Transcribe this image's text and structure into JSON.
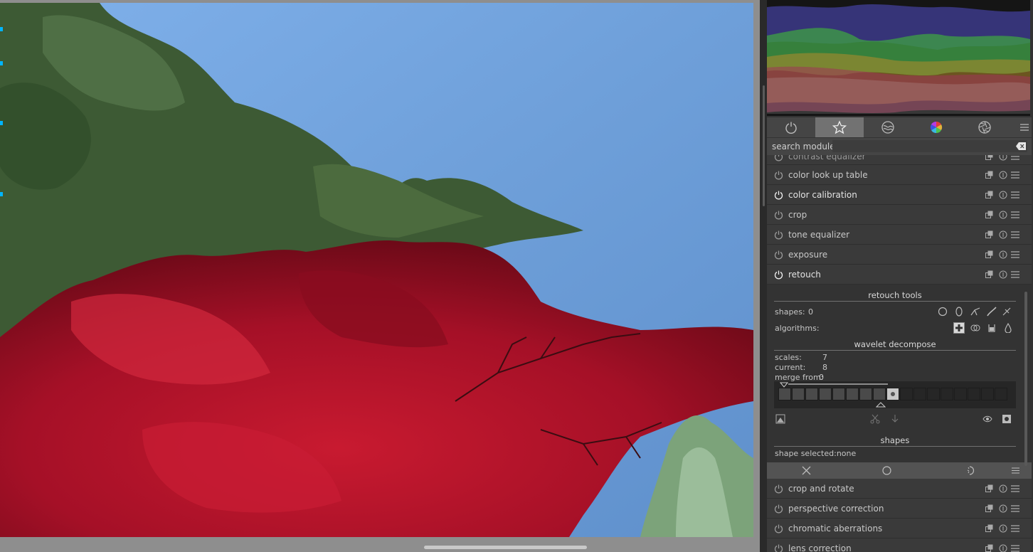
{
  "panel": {
    "search_label": "search module",
    "search_value": "",
    "tabs": [
      {
        "icon": "power-icon",
        "label": ""
      },
      {
        "icon": "star-icon",
        "label": "",
        "active": true
      },
      {
        "icon": "technical-icon",
        "label": ""
      },
      {
        "icon": "color-wheel-icon",
        "label": ""
      },
      {
        "icon": "aperture-icon",
        "label": ""
      }
    ],
    "modules_top": [
      {
        "name": "contrast equalizer",
        "enabled": false,
        "partial": true
      },
      {
        "name": "color look up table",
        "enabled": false
      },
      {
        "name": "color calibration",
        "enabled": true
      },
      {
        "name": "crop",
        "enabled": false
      },
      {
        "name": "tone equalizer",
        "enabled": false
      },
      {
        "name": "exposure",
        "enabled": false
      },
      {
        "name": "retouch",
        "enabled": true,
        "expanded": true
      }
    ],
    "retouch": {
      "tools_title": "retouch tools",
      "shapes_label": "shapes:",
      "shapes_count": "0",
      "algorithms_label": "algorithms:",
      "wavelet_title": "wavelet decompose",
      "scales_label": "scales:",
      "scales_value": "7",
      "current_label": "current:",
      "current_value": "8",
      "merge_label": "merge from:",
      "merge_value": "0",
      "shapes_title": "shapes",
      "shape_selected": "shape selected:none"
    },
    "modules_bottom": [
      {
        "name": "crop and rotate",
        "enabled": false
      },
      {
        "name": "perspective correction",
        "enabled": false
      },
      {
        "name": "chromatic aberrations",
        "enabled": false
      },
      {
        "name": "lens correction",
        "enabled": false
      }
    ]
  },
  "colors": {
    "sky": "#6f9fd8",
    "foliage_red": "#b0142a",
    "foliage_green": "#4a6a3a",
    "active_tab": "#727272",
    "selection_marker": "#00b5ff"
  }
}
